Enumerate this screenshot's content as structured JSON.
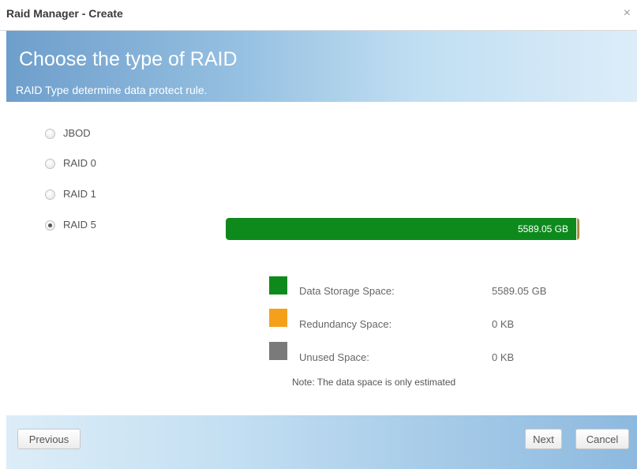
{
  "window": {
    "title": "Raid Manager - Create",
    "close_glyph": "×"
  },
  "header": {
    "heading": "Choose the type of RAID",
    "subheading": "RAID Type determine data protect rule."
  },
  "raid_options": [
    {
      "label": "JBOD",
      "selected": false
    },
    {
      "label": "RAID 0",
      "selected": false
    },
    {
      "label": "RAID 1",
      "selected": false
    },
    {
      "label": "RAID 5",
      "selected": true
    }
  ],
  "capacity_bar": {
    "label": "5589.05 GB",
    "data_fraction": 0.99
  },
  "legend": [
    {
      "label": "Data Storage Space:",
      "value": "5589.05 GB",
      "color": "#0e8a1d"
    },
    {
      "label": "Redundancy Space:",
      "value": "0 KB",
      "color": "#f5a01a"
    },
    {
      "label": "Unused Space:",
      "value": "0 KB",
      "color": "#7a7a7a"
    }
  ],
  "note": "Note: The data space is only estimated",
  "footer": {
    "previous_label": "Previous",
    "next_label": "Next",
    "cancel_label": "Cancel"
  }
}
